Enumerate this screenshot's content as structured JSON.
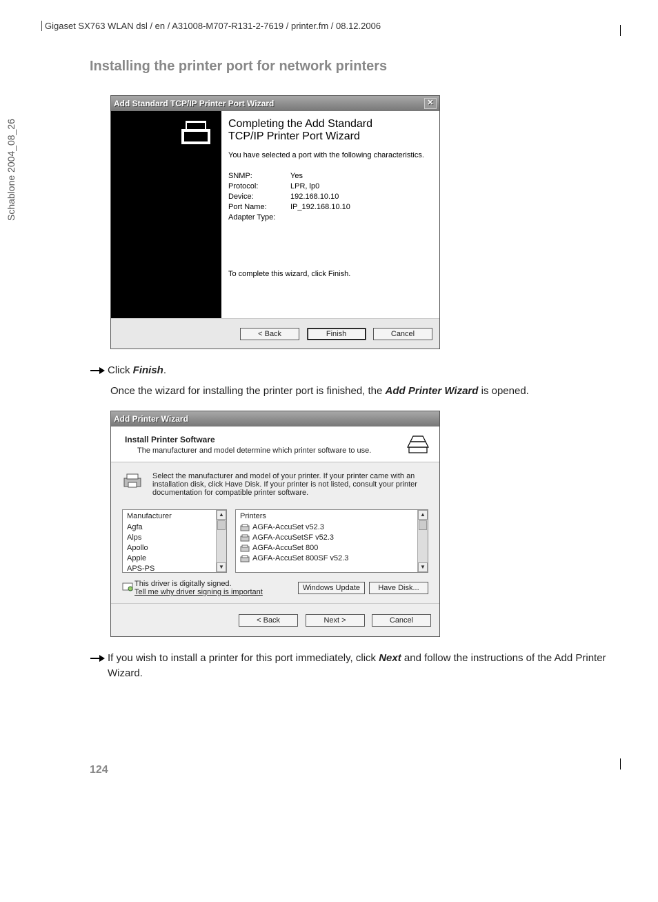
{
  "header": {
    "running": "Gigaset SX763 WLAN dsl / en / A31008-M707-R131-2-7619 / printer.fm / 08.12.2006",
    "side": "Schablone 2004_08_26"
  },
  "section_title": "Installing the printer port for network printers",
  "dialog1": {
    "title": "Add Standard TCP/IP Printer Port Wizard",
    "heading1": "Completing the Add Standard",
    "heading2": "TCP/IP Printer Port Wizard",
    "subtext": "You have selected a port with the following characteristics.",
    "rows": [
      {
        "k": "SNMP:",
        "v": "Yes"
      },
      {
        "k": "Protocol:",
        "v": "LPR, lp0"
      },
      {
        "k": "Device:",
        "v": "192.168.10.10"
      },
      {
        "k": "Port Name:",
        "v": "IP_192.168.10.10"
      },
      {
        "k": "Adapter Type:",
        "v": ""
      }
    ],
    "finish_hint": "To complete this wizard, click Finish.",
    "buttons": {
      "back": "< Back",
      "finish": "Finish",
      "cancel": "Cancel"
    }
  },
  "step1": {
    "pre": "Click ",
    "bold": "Finish",
    "post": "."
  },
  "para1_a": "Once the wizard for installing the printer port is finished, the ",
  "para1_b": "Add Printer Wizard",
  "para1_c": " is opened.",
  "dialog2": {
    "title": "Add Printer Wizard",
    "t1": "Install Printer Software",
    "t2": "The manufacturer and model determine which printer software to use.",
    "info": "Select the manufacturer and model of your printer. If your printer came with an installation disk, click Have Disk. If your printer is not listed, consult your printer documentation for compatible printer software.",
    "manuf_label": "Manufacturer",
    "manufs": [
      "Agfa",
      "Alps",
      "Apollo",
      "Apple",
      "APS-PS"
    ],
    "print_label": "Printers",
    "printers": [
      "AGFA-AccuSet v52.3",
      "AGFA-AccuSetSF v52.3",
      "AGFA-AccuSet 800",
      "AGFA-AccuSet 800SF v52.3"
    ],
    "signed": "This driver is digitally signed.",
    "tell": "Tell me why driver signing is important",
    "winupd": "Windows Update",
    "havedisk": "Have Disk...",
    "buttons": {
      "back": "< Back",
      "next": "Next >",
      "cancel": "Cancel"
    }
  },
  "step2_a": "If you wish to install a printer for this port immediately, click ",
  "step2_b": "Next",
  "step2_c": " and follow the instructions of the Add Printer Wizard.",
  "page_num": "124"
}
